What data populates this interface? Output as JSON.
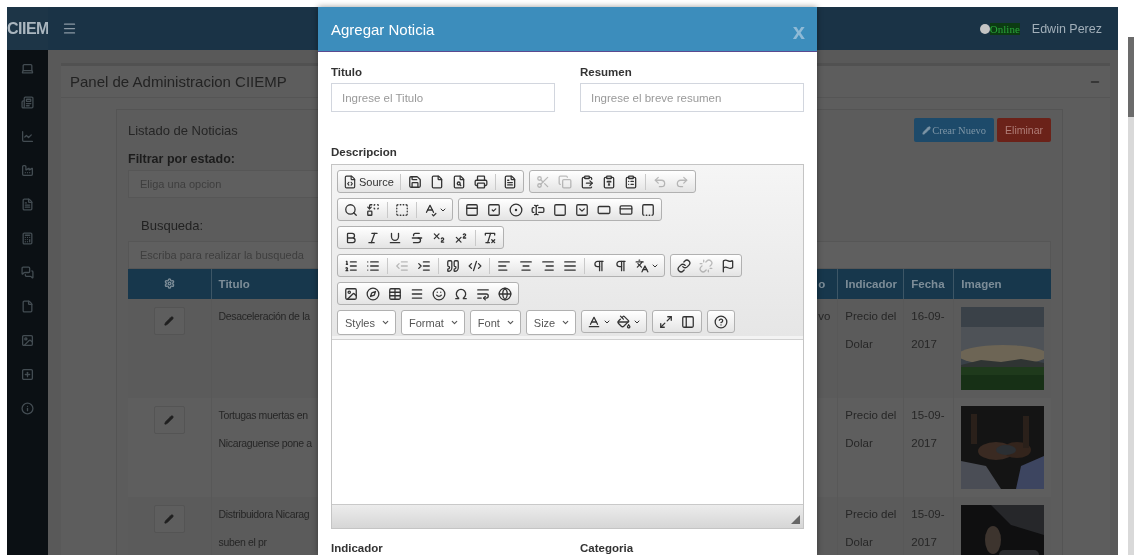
{
  "header": {
    "logo": "CIIEM",
    "status": "Online",
    "user": "Edwin Perez"
  },
  "panel": {
    "title": "Panel de Administracion CIIEMP"
  },
  "news_list": {
    "title": "Listado de Noticias",
    "buttons": [
      {
        "kind": "primary",
        "label": "Crear Nuevo"
      },
      {
        "kind": "danger",
        "label": "Eliminar"
      }
    ],
    "filter_label": "Filtrar por estado:",
    "filter": {
      "placeholder": "Eliga una opcion"
    },
    "search_label": "Busqueda:",
    "search": {
      "placeholder": "Escriba para realizar la busqueda"
    },
    "table": {
      "columns": [
        {
          "kind": "settings"
        },
        {
          "kind": "text",
          "label": "Titulo"
        },
        {
          "kind": "text",
          "label": "o"
        },
        {
          "kind": "text",
          "label": "Indicador"
        },
        {
          "kind": "text",
          "label": "Fecha"
        },
        {
          "kind": "text",
          "label": "Imagen"
        }
      ],
      "rows": [
        {
          "title": [
            "Desaceleración de la"
          ],
          "column_3": "vo",
          "indicador": [
            "Precio del",
            "Dolar"
          ],
          "fecha": [
            "16-09-",
            "2017"
          ],
          "image": {
            "kind": "picture"
          }
        },
        {
          "title": [
            "Tortugas muertas en",
            "Nicaraguense pone a"
          ],
          "indicador": [
            "Precio del",
            "Dolar"
          ],
          "fecha": [
            "15-09-",
            "2017"
          ],
          "image": {
            "kind": "picture"
          }
        },
        {
          "title": [
            "Distribuidora Nicarag",
            "suben el pr"
          ],
          "indicador": [
            "Precio del",
            "Dolar"
          ],
          "fecha": [
            "15-09-",
            "2017"
          ],
          "image": {
            "kind": "picture"
          }
        }
      ]
    }
  },
  "modal": {
    "title": "Agregar Noticia",
    "close": "x",
    "fields": [
      {
        "label": "Titulo",
        "placeholder": "Ingrese el Titulo"
      },
      {
        "label": "Resumen",
        "placeholder": "Ingrese el breve resumen"
      }
    ],
    "description_label": "Descripcion",
    "editor": {
      "toolbar": [
        [
          [
            {
              "kind": "labeled",
              "label": "Source",
              "disabled": false
            },
            {
              "kind": "separator"
            },
            {
              "kind": "button",
              "disabled": false
            },
            {
              "kind": "button",
              "disabled": false
            },
            {
              "kind": "button",
              "disabled": false
            },
            {
              "kind": "button",
              "disabled": false
            },
            {
              "kind": "separator"
            },
            {
              "kind": "button",
              "disabled": false
            }
          ],
          [
            {
              "kind": "button",
              "disabled": true
            },
            {
              "kind": "button",
              "disabled": true
            },
            {
              "kind": "button",
              "disabled": false
            },
            {
              "kind": "button",
              "disabled": false
            },
            {
              "kind": "button",
              "disabled": false
            },
            {
              "kind": "separator"
            },
            {
              "kind": "button",
              "disabled": true
            },
            {
              "kind": "button",
              "disabled": true
            }
          ]
        ],
        [
          [
            {
              "kind": "button",
              "disabled": false
            },
            {
              "kind": "button",
              "disabled": false
            },
            {
              "kind": "separator"
            },
            {
              "kind": "button",
              "disabled": false
            },
            {
              "kind": "separator"
            },
            {
              "kind": "dropdown",
              "disabled": false
            }
          ],
          [
            {
              "kind": "button",
              "disabled": false
            },
            {
              "kind": "button",
              "disabled": false
            },
            {
              "kind": "button",
              "disabled": false
            },
            {
              "kind": "button",
              "disabled": false
            },
            {
              "kind": "button",
              "disabled": false
            },
            {
              "kind": "button",
              "disabled": false
            },
            {
              "kind": "button",
              "disabled": false
            },
            {
              "kind": "button",
              "disabled": false
            },
            {
              "kind": "button",
              "disabled": false
            }
          ]
        ],
        [
          [
            {
              "kind": "button",
              "disabled": false
            },
            {
              "kind": "button",
              "disabled": false
            },
            {
              "kind": "button",
              "disabled": false
            },
            {
              "kind": "button",
              "disabled": false
            },
            {
              "kind": "button",
              "disabled": false
            },
            {
              "kind": "button",
              "disabled": false
            },
            {
              "kind": "separator"
            },
            {
              "kind": "button",
              "disabled": false
            }
          ]
        ],
        [
          [
            {
              "kind": "button",
              "disabled": false
            },
            {
              "kind": "button",
              "disabled": false
            },
            {
              "kind": "separator"
            },
            {
              "kind": "button",
              "disabled": true
            },
            {
              "kind": "button",
              "disabled": false
            },
            {
              "kind": "separator"
            },
            {
              "kind": "button",
              "disabled": false
            },
            {
              "kind": "button",
              "disabled": false
            },
            {
              "kind": "separator"
            },
            {
              "kind": "button",
              "disabled": false
            },
            {
              "kind": "button",
              "disabled": false
            },
            {
              "kind": "button",
              "disabled": false
            },
            {
              "kind": "button",
              "disabled": false
            },
            {
              "kind": "separator"
            },
            {
              "kind": "button",
              "disabled": false
            },
            {
              "kind": "button",
              "disabled": false
            },
            {
              "kind": "dropdown",
              "disabled": false
            }
          ],
          [
            {
              "kind": "button",
              "disabled": false
            },
            {
              "kind": "button",
              "disabled": true
            },
            {
              "kind": "button",
              "disabled": false
            }
          ]
        ],
        [
          [
            {
              "kind": "button",
              "disabled": false
            },
            {
              "kind": "button",
              "disabled": false
            },
            {
              "kind": "button",
              "disabled": false
            },
            {
              "kind": "button",
              "disabled": false
            },
            {
              "kind": "button",
              "disabled": false
            },
            {
              "kind": "button",
              "disabled": false
            },
            {
              "kind": "button",
              "disabled": false
            },
            {
              "kind": "button",
              "disabled": false
            }
          ]
        ],
        [
          [
            {
              "kind": "combo",
              "label": "Styles"
            }
          ],
          [
            {
              "kind": "combo",
              "label": "Format"
            }
          ],
          [
            {
              "kind": "combo",
              "label": "Font"
            }
          ],
          [
            {
              "kind": "combo",
              "label": "Size"
            }
          ],
          [
            {
              "kind": "dropdown",
              "disabled": false
            },
            {
              "kind": "dropdown",
              "disabled": false
            }
          ],
          [
            {
              "kind": "button",
              "disabled": false
            },
            {
              "kind": "button",
              "disabled": false
            }
          ],
          [
            {
              "kind": "button",
              "disabled": false
            }
          ]
        ]
      ]
    },
    "bottom_labels": [
      "Indicador",
      "Categoria"
    ]
  }
}
